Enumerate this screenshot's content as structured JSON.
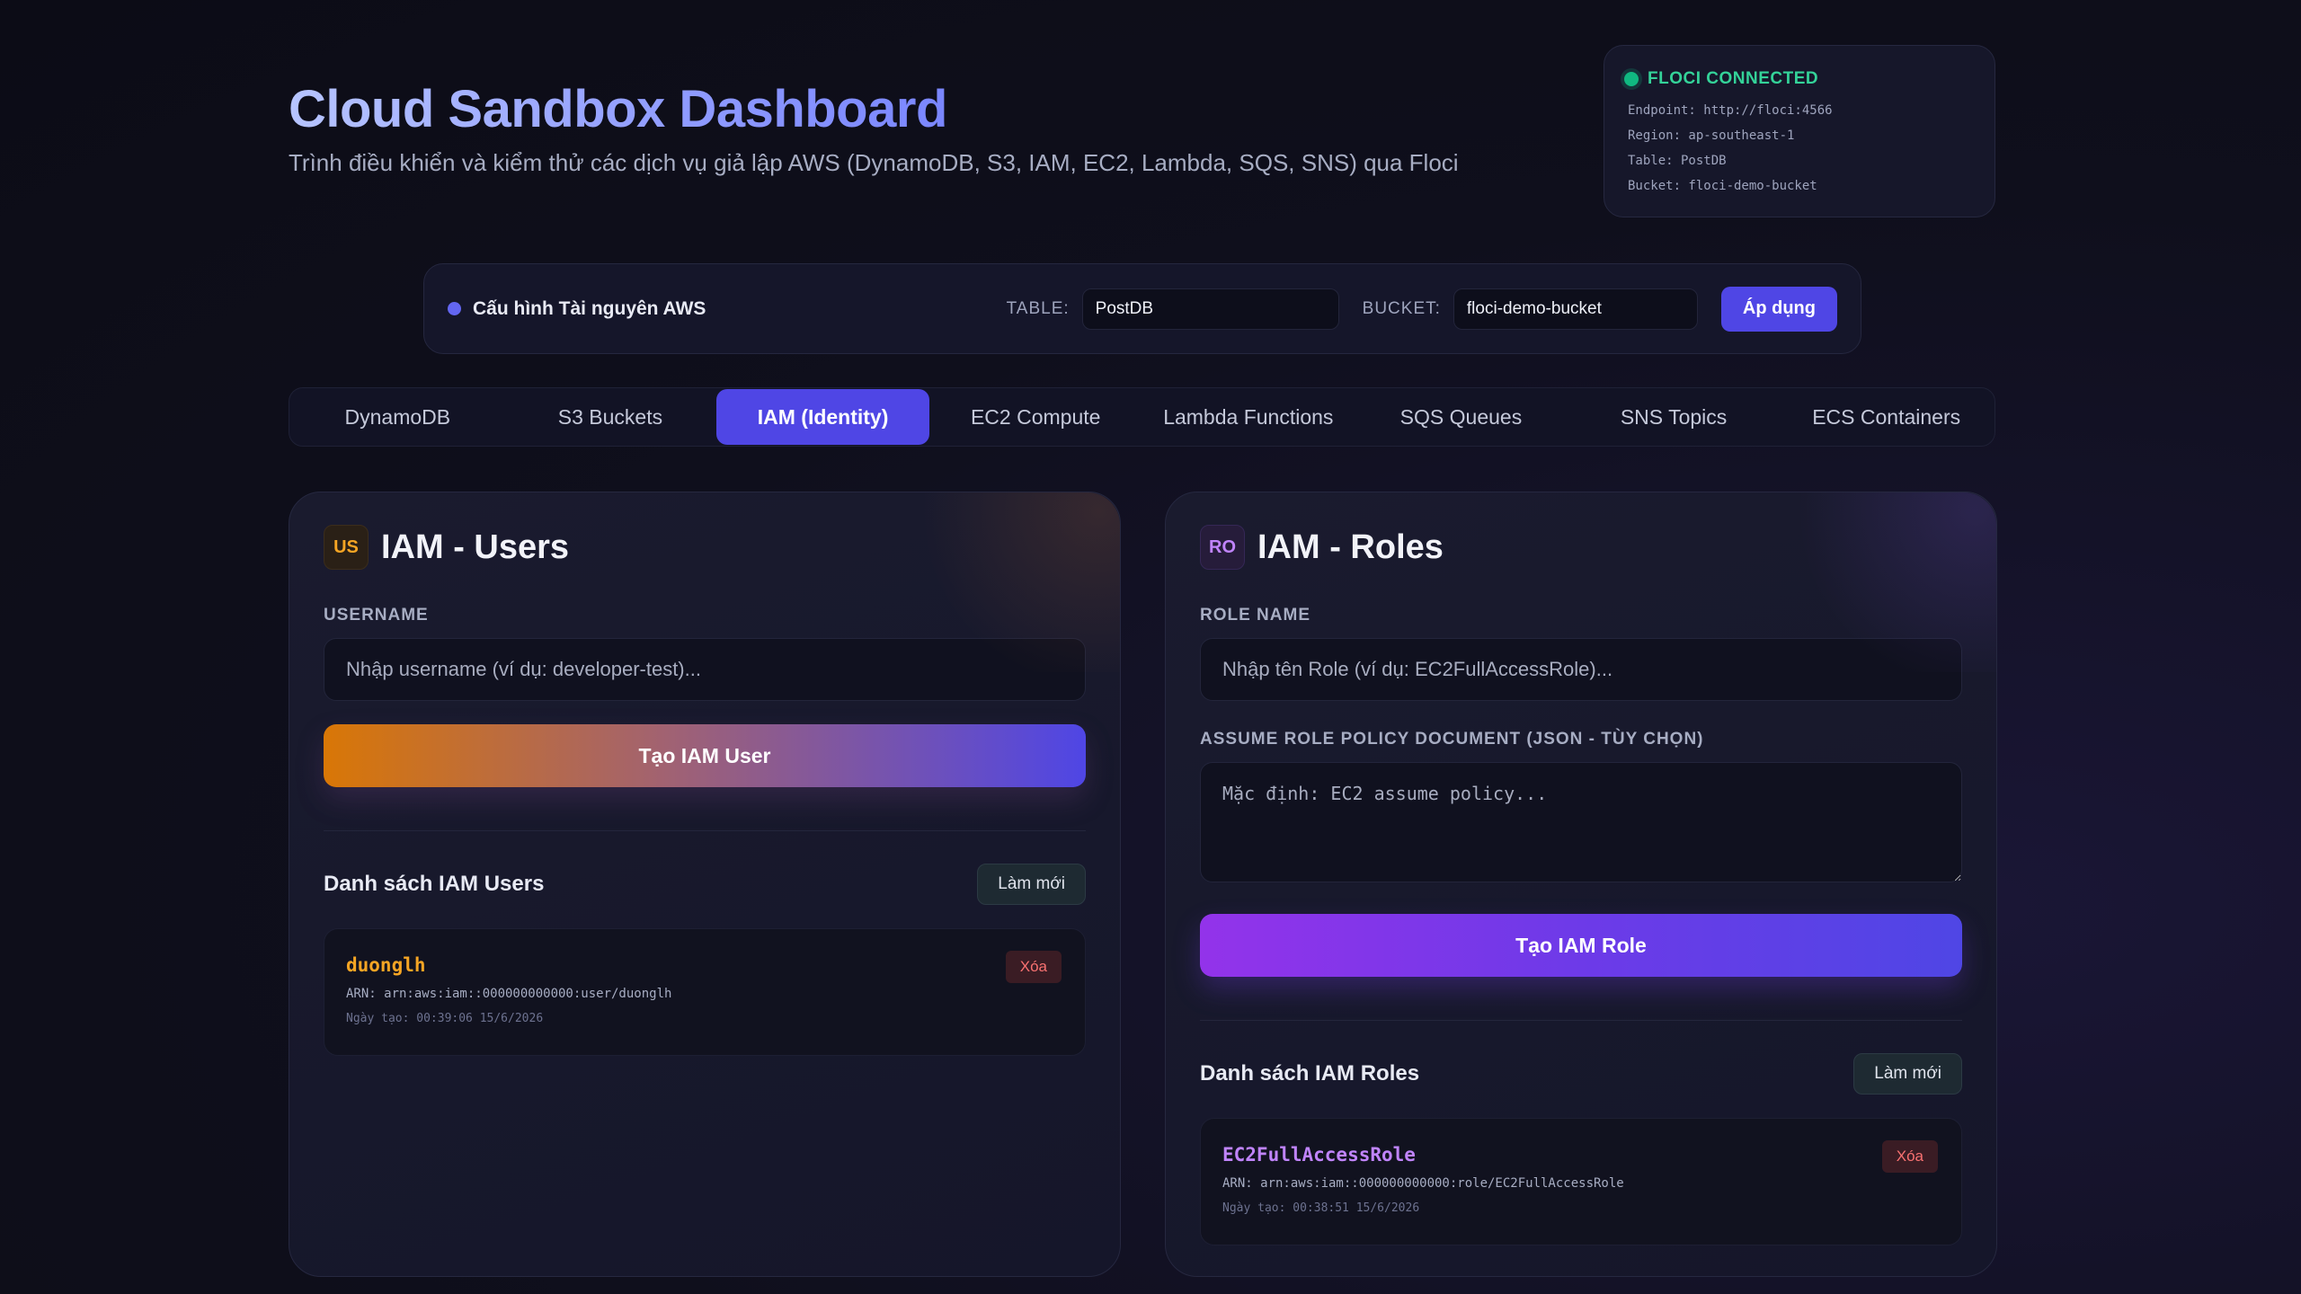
{
  "header": {
    "title": "Cloud Sandbox Dashboard",
    "subtitle": "Trình điều khiển và kiểm thử các dịch vụ giả lập AWS (DynamoDB, S3, IAM, EC2, Lambda, SQS, SNS) qua Floci"
  },
  "status": {
    "title": "FLOCI CONNECTED",
    "endpoint": "Endpoint: http://floci:4566",
    "region": "Region: ap-southeast-1",
    "table": "Table: PostDB",
    "bucket": "Bucket: floci-demo-bucket",
    "color": "#10b981"
  },
  "config": {
    "title": "Cấu hình Tài nguyên AWS",
    "table_label": "TABLE:",
    "table_value": "PostDB",
    "bucket_label": "BUCKET:",
    "bucket_value": "floci-demo-bucket",
    "apply_label": "Áp dụng"
  },
  "tabs": [
    {
      "label": "DynamoDB"
    },
    {
      "label": "S3 Buckets"
    },
    {
      "label": "IAM (Identity)"
    },
    {
      "label": "EC2 Compute"
    },
    {
      "label": "Lambda Functions"
    },
    {
      "label": "SQS Queues"
    },
    {
      "label": "SNS Topics"
    },
    {
      "label": "ECS Containers"
    }
  ],
  "active_tab": "IAM (Identity)",
  "users": {
    "badge": "US",
    "title": "IAM - Users",
    "field_label": "USERNAME",
    "placeholder": "Nhập username (ví dụ: developer-test)...",
    "create_label": "Tạo IAM User",
    "list_title": "Danh sách IAM Users",
    "refresh_label": "Làm mới",
    "items": [
      {
        "name": "duonglh",
        "arn": "ARN: arn:aws:iam::000000000000:user/duonglh",
        "date": "Ngày tạo: 00:39:06 15/6/2026",
        "delete_label": "Xóa"
      }
    ]
  },
  "roles": {
    "badge": "RO",
    "title": "IAM - Roles",
    "field_label": "ROLE NAME",
    "placeholder": "Nhập tên Role (ví dụ: EC2FullAccessRole)...",
    "policy_label": "ASSUME ROLE POLICY DOCUMENT (JSON - TÙY CHỌN)",
    "policy_placeholder": "Mặc định: EC2 assume policy...",
    "create_label": "Tạo IAM Role",
    "list_title": "Danh sách IAM Roles",
    "refresh_label": "Làm mới",
    "items": [
      {
        "name": "EC2FullAccessRole",
        "arn": "ARN: arn:aws:iam::000000000000:role/EC2FullAccessRole",
        "date": "Ngày tạo: 00:38:51 15/6/2026",
        "delete_label": "Xóa"
      }
    ]
  },
  "colors": {
    "accent": "#4f46e5",
    "user_accent": "#f5a524",
    "role_accent": "#c084fc",
    "danger": "#f87171"
  }
}
